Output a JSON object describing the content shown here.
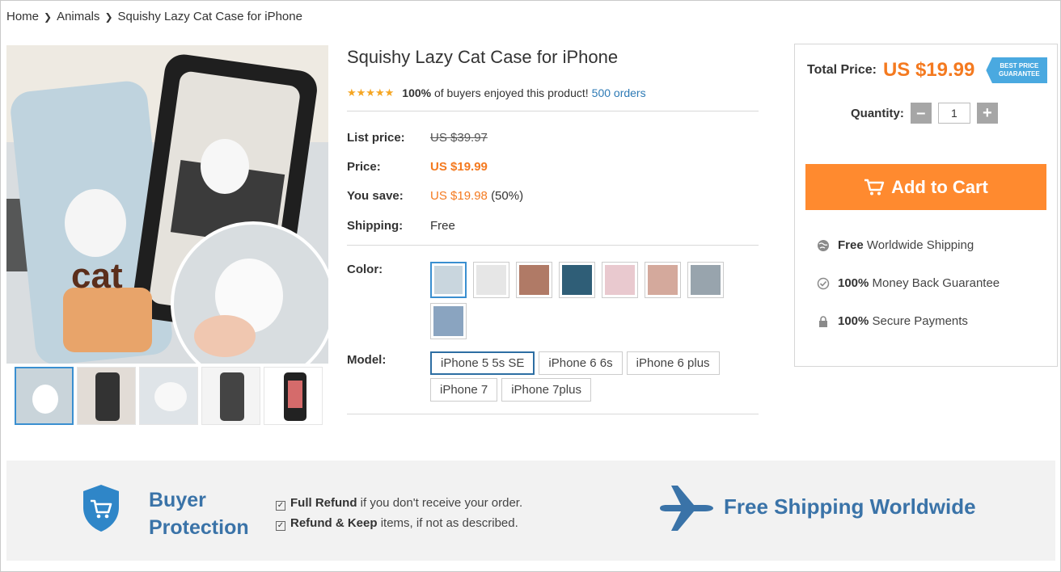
{
  "breadcrumb": {
    "home": "Home",
    "category": "Animals",
    "current": "Squishy Lazy Cat Case for iPhone"
  },
  "product": {
    "title": "Squishy Lazy Cat Case for iPhone",
    "stars_icon": "★★★★★",
    "rating_percent": "100%",
    "rating_text": "of buyers enjoyed this product!",
    "orders": "500 orders"
  },
  "pricing": {
    "list_price_label": "List price:",
    "list_price": "US $39.97",
    "price_label": "Price:",
    "price": "US $19.99",
    "you_save_label": "You save:",
    "you_save": "US $19.98",
    "you_save_pct": "(50%)",
    "shipping_label": "Shipping:",
    "shipping": "Free"
  },
  "color": {
    "label": "Color:",
    "swatches": [
      "#c9d6de",
      "#e6e6e6",
      "#b07a66",
      "#2f5e77",
      "#e9c9cf",
      "#d4a99c",
      "#98a4ad",
      "#8aa4c0"
    ]
  },
  "model": {
    "label": "Model:",
    "options": [
      "iPhone 5 5s SE",
      "iPhone 6 6s",
      "iPhone 6 plus",
      "iPhone 7",
      "iPhone 7plus"
    ],
    "selected": "iPhone 5 5s SE"
  },
  "price_box": {
    "total_label": "Total Price:",
    "total_price": "US $19.99",
    "badge_line1": "BEST PRICE",
    "badge_line2": "GUARANTEE",
    "quantity_label": "Quantity:",
    "quantity_value": "1",
    "minus": "–",
    "plus": "+",
    "add_to_cart": "Add to Cart",
    "assurances": [
      {
        "bold": "Free",
        "text": "Worldwide Shipping"
      },
      {
        "bold": "100%",
        "text": "Money Back Guarantee"
      },
      {
        "bold": "100%",
        "text": "Secure Payments"
      }
    ]
  },
  "bottom": {
    "bp_line1": "Buyer",
    "bp_line2": "Protection",
    "refund_bold": "Full Refund",
    "refund_text": "if you don't receive your order.",
    "keep_bold": "Refund & Keep",
    "keep_text": "items, if not as described.",
    "shipping_title": "Free Shipping Worldwide"
  },
  "colors": {
    "accent": "#f47a20",
    "cart_button": "#ff8a2f",
    "link": "#2d7ab5",
    "band_title": "#3a73a8"
  }
}
